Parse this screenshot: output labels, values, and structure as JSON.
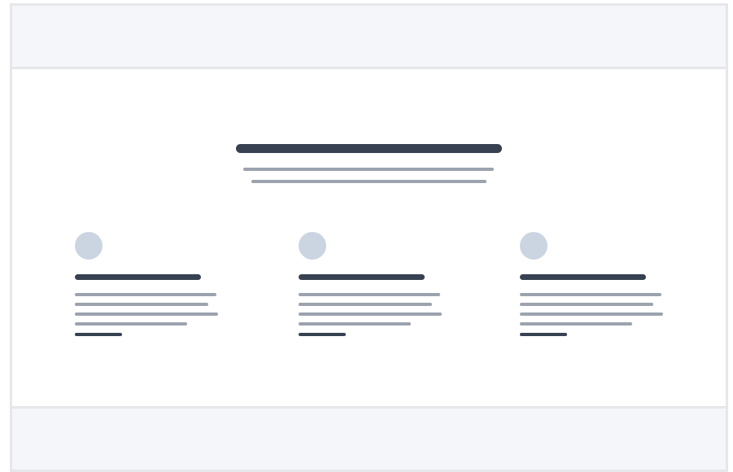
{
  "page": {
    "theme": {
      "frame_border": "#e5e7eb",
      "header_background": "#f4f6fa",
      "main_background": "#ffffff",
      "footer_background": "#f4f6fa",
      "heading_color": "#374151",
      "body_text_color": "#9ca3af",
      "avatar_color": "#cbd5e1"
    }
  },
  "hero": {
    "title": "",
    "subtitle_lines": [
      "",
      ""
    ]
  },
  "cards": [
    {
      "icon": "avatar-placeholder",
      "title": "",
      "description_lines": [
        "",
        "",
        "",
        ""
      ],
      "link": ""
    },
    {
      "icon": "avatar-placeholder",
      "title": "",
      "description_lines": [
        "",
        "",
        "",
        ""
      ],
      "link": ""
    },
    {
      "icon": "avatar-placeholder",
      "title": "",
      "description_lines": [
        "",
        "",
        "",
        ""
      ],
      "link": ""
    }
  ]
}
